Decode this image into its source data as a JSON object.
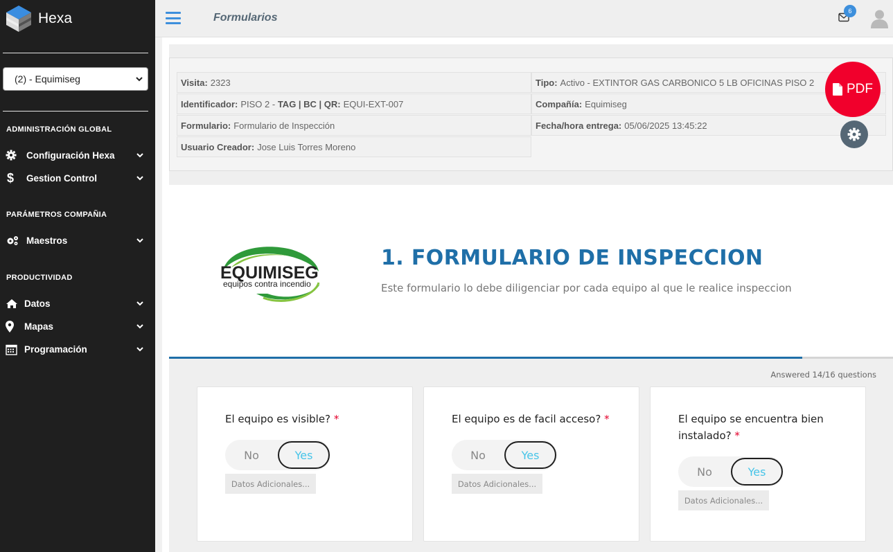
{
  "app": {
    "name": "Hexa",
    "page_title": "Formularios"
  },
  "sidebar": {
    "company_selected": "(2) - Equimiseg",
    "sections": {
      "global": "ADMINISTRACIÓN GLOBAL",
      "company": "PARÁMETROS COMPAÑIA",
      "productivity": "PRODUCTIVIDAD"
    },
    "items": {
      "config": "Configuración Hexa",
      "gestion": "Gestion Control",
      "maestros": "Maestros",
      "datos": "Datos",
      "mapas": "Mapas",
      "programacion": "Programación"
    }
  },
  "topbar": {
    "mail_count": "6"
  },
  "info": {
    "visita_label": "Visita:",
    "visita": "2323",
    "identificador_label": "Identificador:",
    "identificador": "PISO 2",
    "tag_sep": " - ",
    "tag_label": "TAG | BC | QR:",
    "tag": "EQUI-EXT-007",
    "formulario_label": "Formulario:",
    "formulario": "Formulario de Inspección",
    "usuario_label": "Usuario Creador:",
    "usuario": "Jose Luis Torres Moreno",
    "tipo_label": "Tipo:",
    "tipo": "Activo - EXTINTOR GAS CARBONICO 5 LB OFICINAS PISO 2",
    "compania_label": "Compañía:",
    "compania": "Equimiseg",
    "fecha_label": "Fecha/hora entrega:",
    "fecha": "05/06/2025 13:45:22",
    "pdf_label": "PDF"
  },
  "form": {
    "logo_text": "EQUIMISEG",
    "logo_subtext": "equipos contra incendio",
    "title": "1. FORMULARIO DE INSPECCION",
    "description": "Este formulario lo debe diligenciar por cada equipo al que le realice inspeccion",
    "answered": "Answered 14/16 questions",
    "progress": 0.875
  },
  "questions": [
    {
      "title": "El equipo es visible?",
      "required": "*",
      "no": "No",
      "yes": "Yes",
      "selected": "Yes",
      "extra": "Datos Adicionales..."
    },
    {
      "title": "El equipo es de facil acceso?",
      "required": "*",
      "no": "No",
      "yes": "Yes",
      "selected": "Yes",
      "extra": "Datos Adicionales..."
    },
    {
      "title": "El equipo se encuentra bien instalado?",
      "required": "*",
      "no": "No",
      "yes": "Yes",
      "selected": "Yes",
      "extra": "Datos Adicionales..."
    }
  ],
  "colors": {
    "accent": "#1f6fa8",
    "pdf": "#f1002c",
    "sidebar": "#1f1f1f",
    "yes": "#46c4e8",
    "menu": "#3d8fdc"
  }
}
